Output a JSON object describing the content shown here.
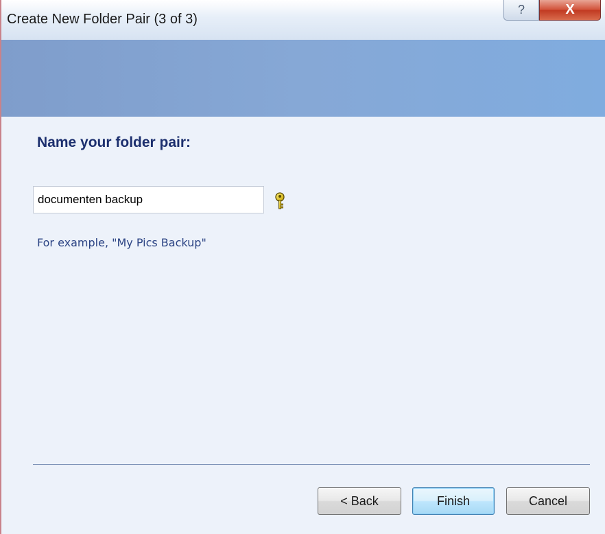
{
  "window": {
    "title": "Create New Folder Pair (3 of 3)",
    "help_glyph": "?",
    "close_glyph": "X"
  },
  "wizard": {
    "heading": "Name your folder pair:",
    "folder_name_value": "documenten backup",
    "example_text": "For example, \"My Pics Backup\""
  },
  "buttons": {
    "back_label": "< Back",
    "finish_label": "Finish",
    "cancel_label": "Cancel"
  },
  "icons": {
    "hint": "key-icon"
  },
  "colors": {
    "heading": "#1c2f6e",
    "example_text": "#2c4484",
    "banner": "#80a4d8",
    "content_background": "#edf2fa",
    "close_button": "#c13a22"
  }
}
